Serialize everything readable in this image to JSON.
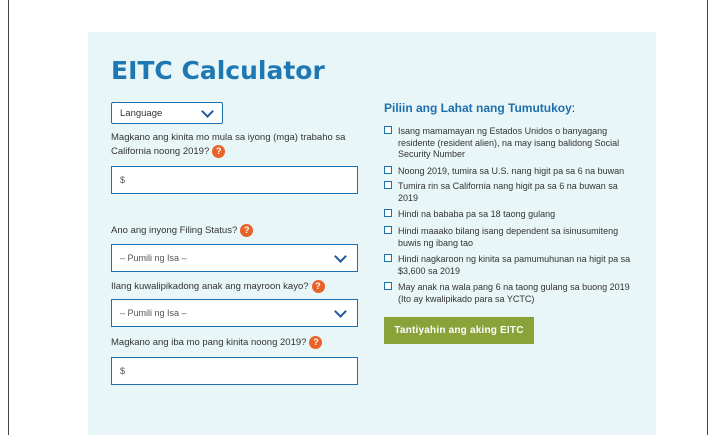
{
  "title": "EITC Calculator",
  "language_select": {
    "value": "Language"
  },
  "questions": {
    "income": "Magkano ang kinita mo mula sa iyong (mga) trabaho sa California noong 2019?",
    "income_placeholder": "$",
    "filing_status": "Ano ang inyong Filing Status?",
    "filing_status_value": "– Pumili ng Isa –",
    "children": "Ilang kuwalipikadong anak ang mayroon kayo?",
    "children_value": "– Pumili ng Isa –",
    "other_income": "Magkano ang iba mo pang kinita noong 2019?",
    "other_income_placeholder": "$"
  },
  "help_glyph": "?",
  "checklist": {
    "title": "Piliin ang Lahat nang Tumutukoy",
    "colon": ":",
    "items": [
      "Isang mamamayan ng Estados Unidos o banyagang residente (resident alien), na may isang balidong Social Security Number",
      "Noong 2019, tumira sa U.S. nang higit pa sa 6 na buwan",
      "Tumira rin sa California nang higit pa sa 6 na buwan sa 2019",
      "Hindi na bababa pa sa 18 taong gulang",
      "Hindi maaako bilang isang dependent sa isinusumiteng buwis ng ibang tao",
      "Hindi nagkaroon ng kinita sa pamumuhunan na higit pa sa $3,600 sa 2019",
      "May anak na wala pang 6 na taong gulang sa buong 2019 (Ito ay kwalipikado para sa YCTC)"
    ]
  },
  "submit_label": "Tantiyahin ang aking EITC",
  "colors": {
    "brand_blue": "#1e78b4",
    "help_orange": "#e8622a",
    "button_green": "#8aa23a",
    "panel_bg": "#e8f6f8"
  }
}
